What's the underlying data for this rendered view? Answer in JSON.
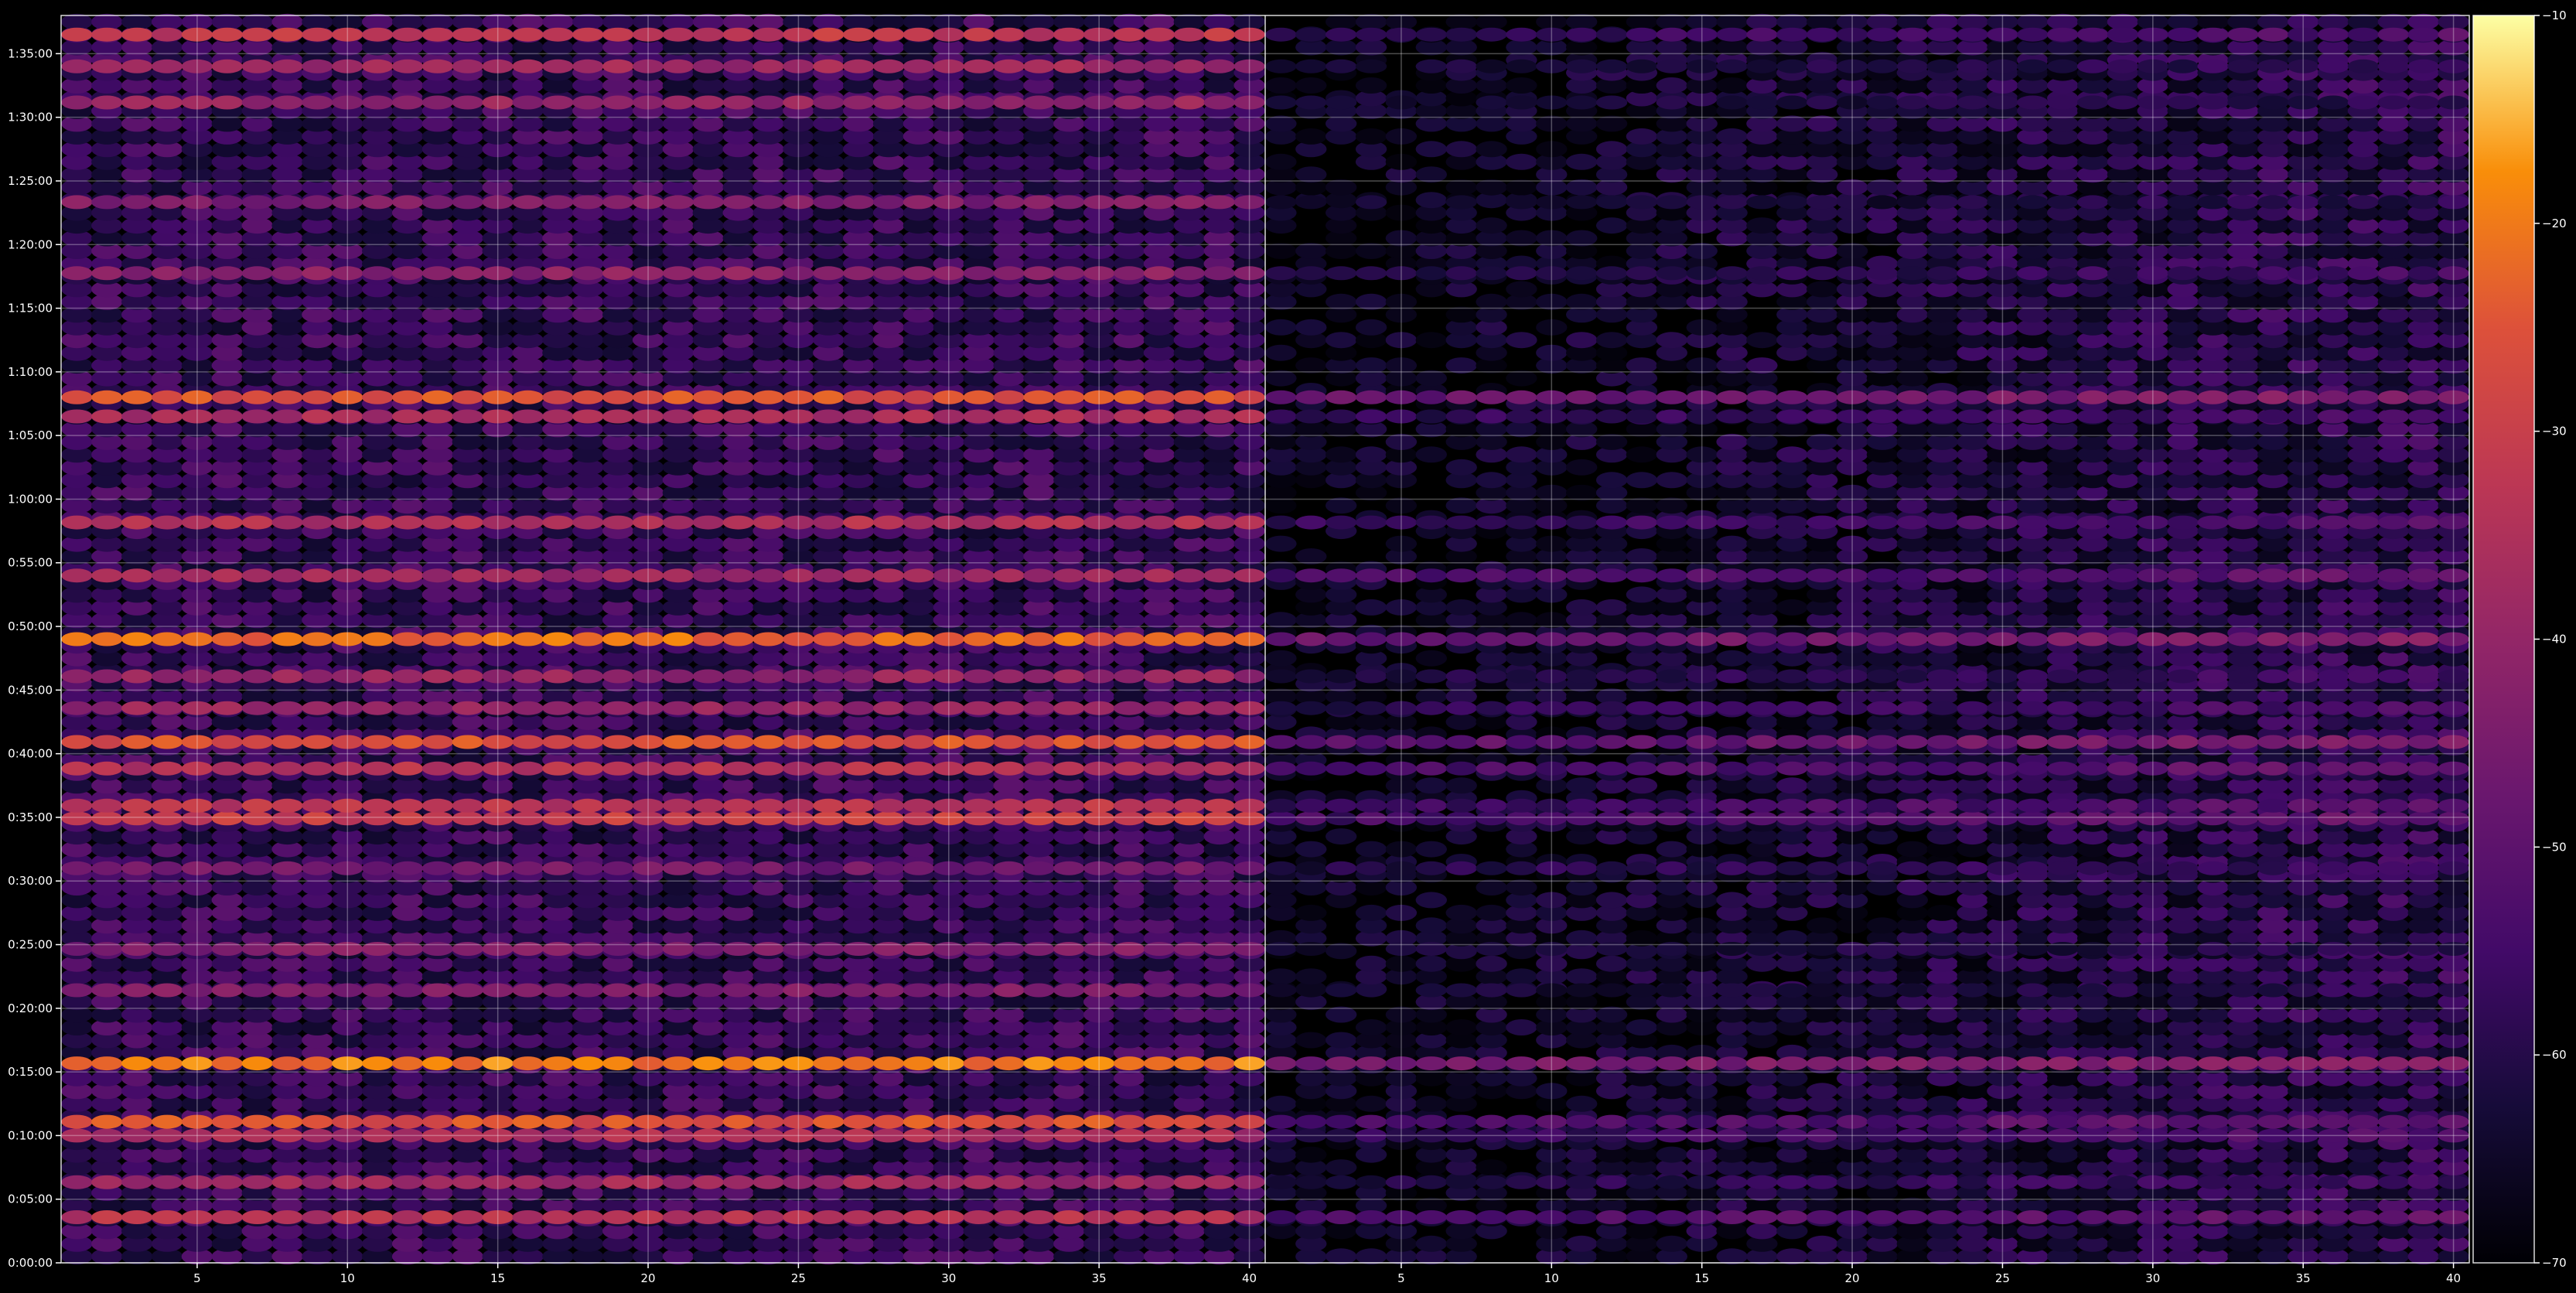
{
  "chart_data": {
    "type": "heatmap",
    "title": "",
    "xlabel": "",
    "ylabel": "",
    "colormap": "inferno",
    "background": "#000000",
    "grid": true,
    "panels": [
      {
        "name": "",
        "xlim": [
          1,
          40
        ],
        "x_ticks": [
          5,
          10,
          15,
          20,
          25,
          30,
          35,
          40
        ],
        "x_tick_labels": [
          "5",
          "10",
          "15",
          "20",
          "25",
          "30",
          "35",
          "40"
        ],
        "base_level": -57,
        "column_gain": 0
      },
      {
        "name": "",
        "xlim": [
          1,
          40
        ],
        "x_ticks": [
          5,
          10,
          15,
          20,
          25,
          30,
          35,
          40
        ],
        "x_tick_labels": [
          "5",
          "10",
          "15",
          "20",
          "25",
          "30",
          "35",
          "40"
        ],
        "base_level": -68,
        "column_gain": 0.25
      }
    ],
    "ylim_seconds": [
      0,
      5880
    ],
    "y_ticks_seconds": [
      0,
      300,
      600,
      900,
      1200,
      1500,
      1800,
      2100,
      2400,
      2700,
      3000,
      3300,
      3600,
      3900,
      4200,
      4500,
      4800,
      5100,
      5400,
      5700
    ],
    "y_tick_labels": [
      "0:00:00",
      "0:05:00",
      "0:10:00",
      "0:15:00",
      "0:20:00",
      "0:25:00",
      "0:30:00",
      "0:35:00",
      "0:40:00",
      "0:45:00",
      "0:50:00",
      "0:55:00",
      "1:00:00",
      "1:05:00",
      "1:10:00",
      "1:15:00",
      "1:20:00",
      "1:25:00",
      "1:30:00",
      "1:35:00"
    ],
    "colorbar": {
      "range": [
        -70,
        -10
      ],
      "ticks": [
        -10,
        -20,
        -30,
        -40,
        -50,
        -60,
        -70
      ],
      "tick_labels": [
        "−10",
        "−20",
        "−30",
        "−40",
        "−50",
        "−60",
        "−70"
      ]
    },
    "bands": [
      {
        "t": 215,
        "left": -34,
        "right": -52
      },
      {
        "t": 380,
        "left": -38,
        "right": -58
      },
      {
        "t": 600,
        "left": -36,
        "right": -55
      },
      {
        "t": 665,
        "left": -26,
        "right": -52
      },
      {
        "t": 940,
        "left": -20,
        "right": -44
      },
      {
        "t": 1285,
        "left": -44,
        "right": -62
      },
      {
        "t": 1480,
        "left": -44,
        "right": -62
      },
      {
        "t": 1860,
        "left": -46,
        "right": -58
      },
      {
        "t": 2095,
        "left": -30,
        "right": -52
      },
      {
        "t": 2155,
        "left": -33,
        "right": -54
      },
      {
        "t": 2330,
        "left": -34,
        "right": -52
      },
      {
        "t": 2455,
        "left": -26,
        "right": -48
      },
      {
        "t": 2615,
        "left": -40,
        "right": -56
      },
      {
        "t": 2765,
        "left": -40,
        "right": -58
      },
      {
        "t": 2940,
        "left": -22,
        "right": -46
      },
      {
        "t": 3240,
        "left": -38,
        "right": -52
      },
      {
        "t": 3490,
        "left": -35,
        "right": -55
      },
      {
        "t": 3990,
        "left": -36,
        "right": -56
      },
      {
        "t": 4080,
        "left": -26,
        "right": -46
      },
      {
        "t": 4665,
        "left": -42,
        "right": -58
      },
      {
        "t": 5000,
        "left": -44,
        "right": -62
      },
      {
        "t": 5470,
        "left": -40,
        "right": -62
      },
      {
        "t": 5640,
        "left": -38,
        "right": -60
      },
      {
        "t": 5790,
        "left": -32,
        "right": -55
      }
    ]
  }
}
